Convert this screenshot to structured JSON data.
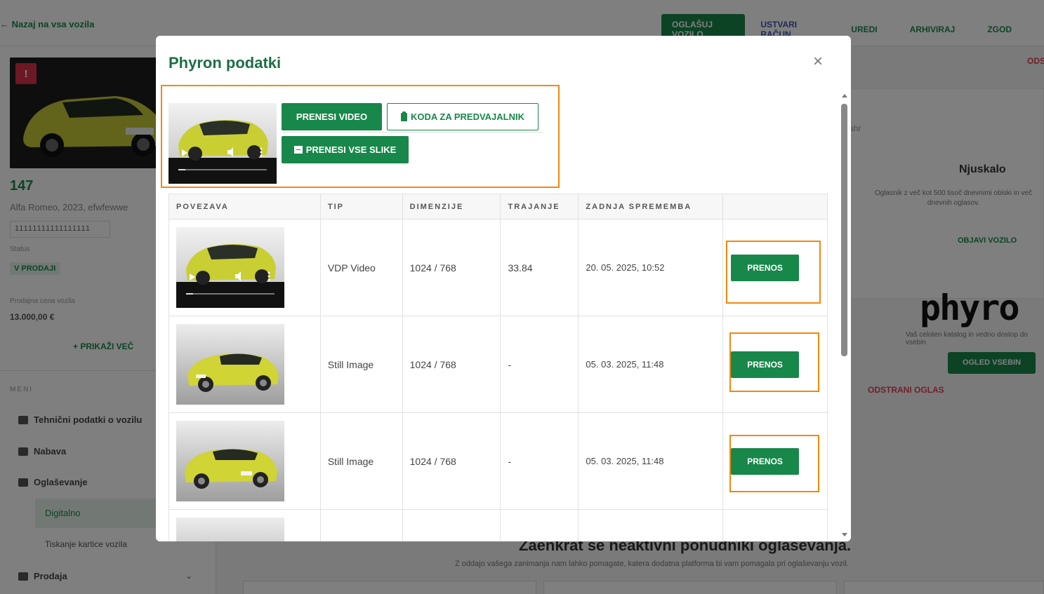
{
  "background": {
    "back_link": "← Nazaj na vsa vozila",
    "nav": {
      "primary": "OGLAŠUJ VOZILO",
      "create_account": "USTVARI RAČUN",
      "edit": "UREDI",
      "archive": "ARHIVIRAJ",
      "history": "ZGOD"
    },
    "sidebar": {
      "warning": "!",
      "vehicle_id": "147",
      "vehicle_desc": "Alfa Romeo, 2023, efwfewwe",
      "vin": "11111111111111111",
      "status_label": "Status",
      "status_value": "V PRODAJI",
      "price_label": "Prodajna cena vozila",
      "price_value": "13.000,00 €",
      "show_more": "+ PRIKAŽI VEČ",
      "menu_head": "MENI",
      "menu": [
        "Tehnični podatki o vozilu",
        "Nabava",
        "Oglaševanje",
        "Prodaja"
      ],
      "sub_active": "Digitalno",
      "sub_other": "Tiskanje kartice vozila",
      "chevron": "⌄"
    },
    "right": {
      "top_red": "ODS",
      "ahr": "ahr",
      "nj_title": "Njuskalo",
      "nj_desc": "Oglasnik z več kot 500 tisoč dnevnimi obiski in več dnevnih oglasov.",
      "nj_link": "OBJAVI VOZILO",
      "phyron_logo": "phyro",
      "phyron_desc": "Vaš celoten katalog in vedno dostop do vsebin",
      "phyron_btn": "OGLED VSEBIN",
      "delete_ad": "ODSTRANI OGLAS",
      "bottom_title": "Zaenkrat še neaktivni ponudniki oglaševanja.",
      "bottom_sub": "Z oddajo vašega zanimanja nam lahko pomagate, katera dodatna platforma bi vam pomagala pri oglaševanju vozil."
    }
  },
  "modal": {
    "title": "Phyron podatki",
    "close": "×",
    "buttons": {
      "download_video": "PRENESI VIDEO",
      "player_code": "KODA ZA PREDVAJALNIK",
      "download_all_images": "PRENESI VSE SLIKE"
    },
    "table": {
      "headers": [
        "POVEZAVA",
        "TIP",
        "DIMENZIJE",
        "TRAJANJE",
        "ZADNJA SPREMEMBA",
        ""
      ],
      "rows": [
        {
          "type": "VDP Video",
          "dimensions": "1024 / 768",
          "duration": "33.84",
          "modified": "20. 05. 2025, 10:52",
          "action": "PRENOS"
        },
        {
          "type": "Still Image",
          "dimensions": "1024 / 768",
          "duration": "-",
          "modified": "05. 03. 2025, 11:48",
          "action": "PRENOS"
        },
        {
          "type": "Still Image",
          "dimensions": "1024 / 768",
          "duration": "-",
          "modified": "05. 03. 2025, 11:48",
          "action": "PRENOS"
        }
      ]
    }
  },
  "colors": {
    "brand_green": "#18874a",
    "title_green": "#1e6e46",
    "highlight_orange": "#f0890c",
    "car_yellow": "#c9cf33"
  }
}
